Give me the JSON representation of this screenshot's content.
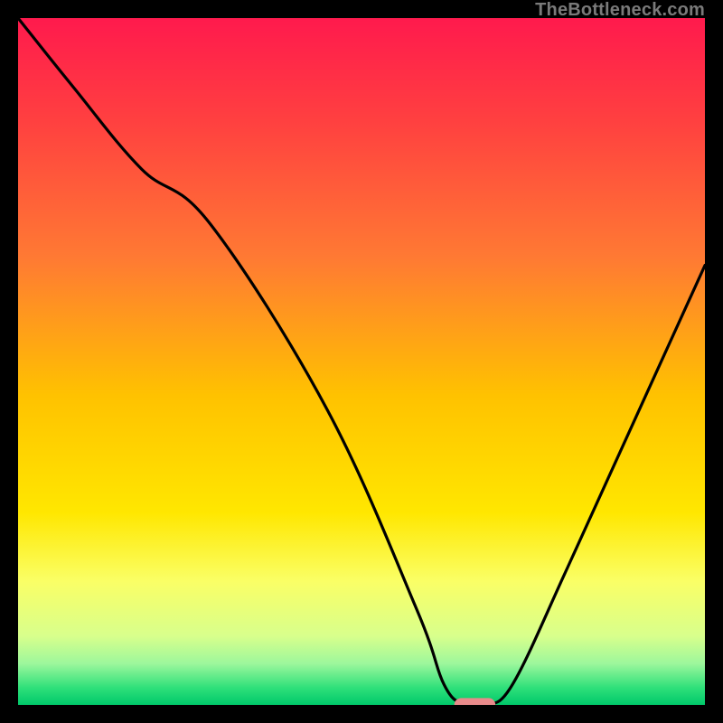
{
  "watermark": "TheBottleneck.com",
  "chart_data": {
    "type": "line",
    "title": "",
    "xlabel": "",
    "ylabel": "",
    "xlim": [
      0,
      100
    ],
    "ylim": [
      0,
      100
    ],
    "grid": false,
    "legend": false,
    "series": [
      {
        "name": "bottleneck-curve",
        "color": "#000000",
        "x": [
          0,
          8,
          18,
          28,
          45,
          58,
          62,
          65,
          68,
          72,
          80,
          90,
          100
        ],
        "y": [
          100,
          90,
          78,
          70,
          43,
          14,
          3,
          0,
          0,
          3,
          20,
          42,
          64
        ]
      }
    ],
    "marker": {
      "name": "optimal-range",
      "shape": "pill",
      "color": "#e88a8a",
      "x_center": 66.5,
      "y_center": 0,
      "width_x": 6,
      "height_y": 2
    },
    "background_gradient": {
      "stops": [
        {
          "pos": 0.0,
          "color": "#ff1a4d"
        },
        {
          "pos": 0.15,
          "color": "#ff4040"
        },
        {
          "pos": 0.35,
          "color": "#ff7a33"
        },
        {
          "pos": 0.55,
          "color": "#ffc200"
        },
        {
          "pos": 0.72,
          "color": "#ffe700"
        },
        {
          "pos": 0.82,
          "color": "#faff66"
        },
        {
          "pos": 0.9,
          "color": "#d8ff8c"
        },
        {
          "pos": 0.94,
          "color": "#9cf79c"
        },
        {
          "pos": 0.975,
          "color": "#2fe07a"
        },
        {
          "pos": 1.0,
          "color": "#00c86a"
        }
      ]
    }
  }
}
